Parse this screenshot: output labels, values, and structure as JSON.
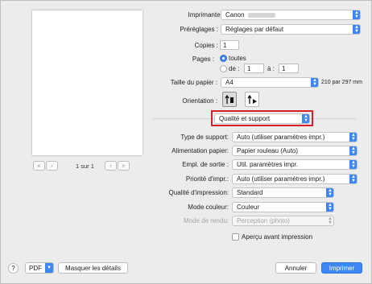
{
  "preview": {
    "first_page_icon": "«",
    "prev_page_icon": "‹",
    "next_page_icon": "›",
    "last_page_icon": "»",
    "page_indicator": "1 sur 1"
  },
  "printer": {
    "label": "Imprimante :",
    "value": "Canon"
  },
  "presets": {
    "label": "Préréglages :",
    "value": "Réglages par défaut"
  },
  "copies": {
    "label": "Copies :",
    "value": "1"
  },
  "pages": {
    "label": "Pages :",
    "all_label": "toutes",
    "from_label": "de :",
    "from_value": "1",
    "to_label": "à :",
    "to_value": "1",
    "selected": "all"
  },
  "paper_size": {
    "label": "Taille du papier :",
    "value": "A4",
    "dimensions": "210 par 297 mm"
  },
  "orientation": {
    "label": "Orientation :",
    "selected": "portrait"
  },
  "panel": {
    "value": "Qualité et support"
  },
  "media_type": {
    "label": "Type de support:",
    "value": "Auto (utiliser paramètres impr.)"
  },
  "paper_source": {
    "label": "Alimentation papier:",
    "value": "Papier rouleau (Auto)"
  },
  "output_method": {
    "label": "Empl. de sortie :",
    "value": "Util. paramètres impr."
  },
  "print_priority": {
    "label": "Priorité d'impr.:",
    "value": "Auto (utiliser paramètres impr.)"
  },
  "print_quality": {
    "label": "Qualité d'impression:",
    "value": "Standard"
  },
  "color_mode": {
    "label": "Mode couleur:",
    "value": "Couleur"
  },
  "matching_mode": {
    "label": "Mode de rendu:",
    "value": "Perception (photo)"
  },
  "preview_check": {
    "label": "Aperçu avant impression",
    "checked": false
  },
  "footer": {
    "help_label": "?",
    "pdf_label": "PDF",
    "hide_details_label": "Masquer les détails",
    "cancel_label": "Annuler",
    "print_label": "Imprimer"
  },
  "colors": {
    "accent": "#3c86f5",
    "highlight": "#d61f26"
  }
}
